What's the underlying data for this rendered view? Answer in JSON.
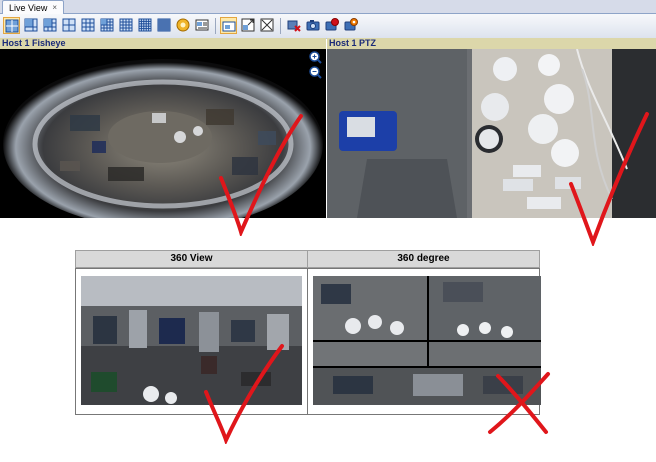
{
  "window": {
    "tab_label": "Live View",
    "tab_close": "×"
  },
  "toolbar": {
    "buttons": [
      {
        "name": "layout-1x1-icon",
        "selected": true
      },
      {
        "name": "layout-1plus3-icon"
      },
      {
        "name": "layout-1plus5-icon"
      },
      {
        "name": "layout-2x2-icon"
      },
      {
        "name": "layout-3x3-icon"
      },
      {
        "name": "layout-1plus7-icon"
      },
      {
        "name": "layout-4x4-icon"
      },
      {
        "name": "layout-5x5-icon"
      },
      {
        "name": "sequence-icon"
      },
      {
        "name": "monitor-info-icon"
      },
      {
        "name": "single-view-icon",
        "selected": true
      },
      {
        "name": "popout-view-icon"
      },
      {
        "name": "fullscreen-icon"
      },
      {
        "name": "disconnect-icon"
      },
      {
        "name": "snapshot-icon"
      },
      {
        "name": "record-icon"
      },
      {
        "name": "manual-record-icon"
      }
    ]
  },
  "panes": {
    "fisheye_title": "Host 1 Fisheye",
    "ptz_title": "Host 1 PTZ"
  },
  "comparison": {
    "left_header": "360 View",
    "right_header": "360 degree"
  },
  "marks": {
    "check_color": "#e0161b",
    "cross_color": "#e0161b"
  }
}
